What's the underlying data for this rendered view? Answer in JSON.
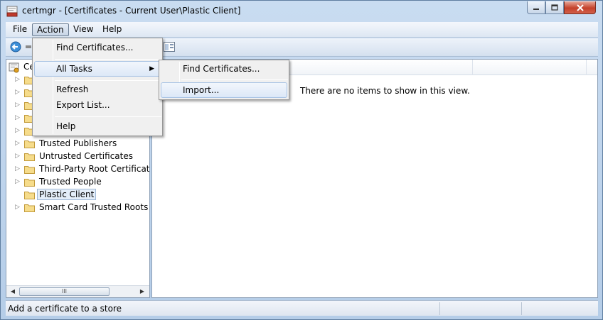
{
  "window": {
    "title": "certmgr - [Certificates - Current User\\Plastic Client]"
  },
  "menubar": {
    "items": [
      {
        "label": "File"
      },
      {
        "label": "Action"
      },
      {
        "label": "View"
      },
      {
        "label": "Help"
      }
    ]
  },
  "tree": {
    "root_label": "Ce",
    "items": [
      {
        "label": "Trusted Publishers"
      },
      {
        "label": "Untrusted Certificates"
      },
      {
        "label": "Third-Party Root Certification"
      },
      {
        "label": "Trusted People"
      },
      {
        "label": "Plastic Client",
        "selected": true
      },
      {
        "label": "Smart Card Trusted Roots"
      }
    ],
    "hscroll_grip": "III"
  },
  "list": {
    "empty_message": "There are no items to show in this view."
  },
  "action_menu": {
    "items": [
      {
        "label": "Find Certificates..."
      },
      {
        "label": "All Tasks"
      },
      {
        "label": "Refresh"
      },
      {
        "label": "Export List..."
      },
      {
        "label": "Help"
      }
    ]
  },
  "all_tasks_menu": {
    "items": [
      {
        "label": "Find Certificates..."
      },
      {
        "label": "Import..."
      }
    ]
  },
  "statusbar": {
    "text": "Add a certificate to a store"
  },
  "icons": [
    "certmgr-app-icon",
    "minimize-icon",
    "maximize-icon",
    "close-icon",
    "back-arrow-icon",
    "folder-icon",
    "expand-arrow-icon",
    "submenu-arrow-icon"
  ]
}
